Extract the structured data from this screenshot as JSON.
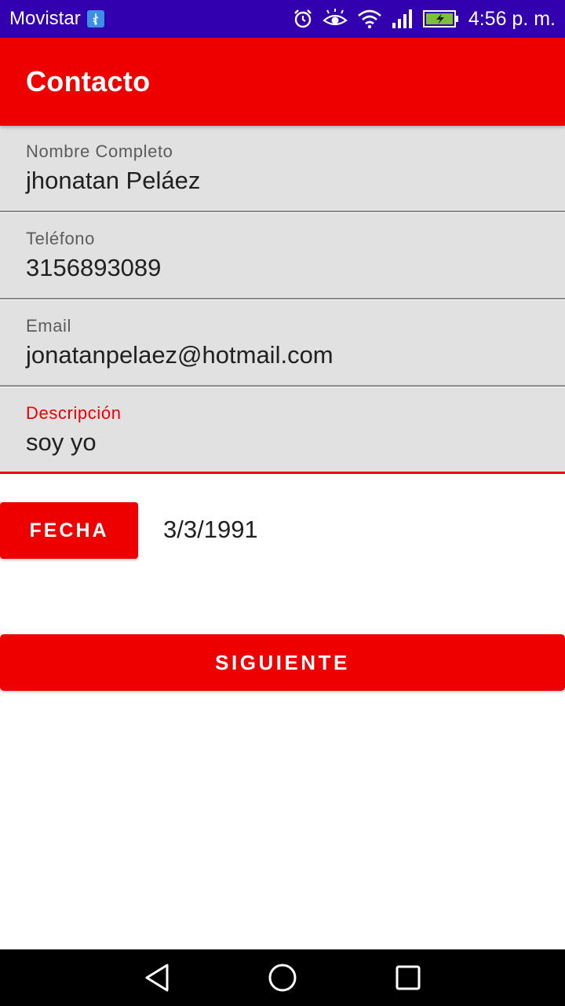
{
  "status_bar": {
    "carrier": "Movistar",
    "time": "4:56 p. m.",
    "icons": [
      "usb-icon",
      "alarm-icon",
      "eye-comfort-icon",
      "wifi-icon",
      "signal-icon",
      "battery-charging-icon"
    ]
  },
  "app_bar": {
    "title": "Contacto"
  },
  "form": {
    "fields": [
      {
        "label": "Nombre Completo",
        "value": "jhonatan Peláez"
      },
      {
        "label": "Teléfono",
        "value": "3156893089"
      },
      {
        "label": "Email",
        "value": "jonatanpelaez@hotmail.com"
      },
      {
        "label": "Descripción",
        "value": "soy yo"
      }
    ],
    "date_button_label": "FECHA",
    "date_value": "3/3/1991",
    "next_button_label": "SIGUIENTE"
  },
  "nav_bar": {
    "icons": [
      "back-icon",
      "home-icon",
      "recents-icon"
    ]
  },
  "colors": {
    "status_bar": "#3300b0",
    "primary": "#ee0000",
    "field_bg": "#e1e1e1"
  }
}
